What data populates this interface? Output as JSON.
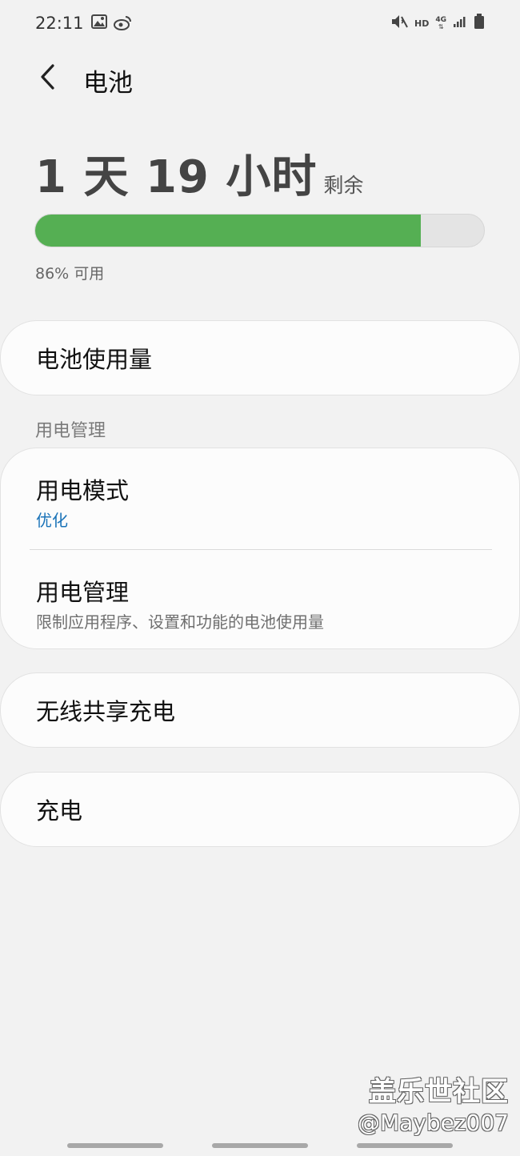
{
  "status_bar": {
    "time": "22:11",
    "hd_label": "HD",
    "network_label": "4G",
    "icons": [
      "image-icon",
      "weibo-icon",
      "mute-icon",
      "signal-icon",
      "battery-icon"
    ]
  },
  "header": {
    "title": "电池",
    "back_icon": "chevron-left-icon"
  },
  "battery": {
    "remaining_time": "1 天 19 小时",
    "remaining_suffix": "剩余",
    "percent": 86,
    "available_label": "86% 可用",
    "bar_color": "#55af53"
  },
  "cards": {
    "battery_usage": "电池使用量",
    "section_power_header": "用电管理",
    "power_mode_title": "用电模式",
    "power_mode_value": "优化",
    "power_mode_value_color": "#1a73b8",
    "power_management_title": "用电管理",
    "power_management_desc": "限制应用程序、设置和功能的电池使用量",
    "wireless_powershare": "无线共享充电",
    "charging": "充电"
  },
  "watermark": {
    "logo_text": "盖乐世社区",
    "user_text": "@Maybez007"
  }
}
